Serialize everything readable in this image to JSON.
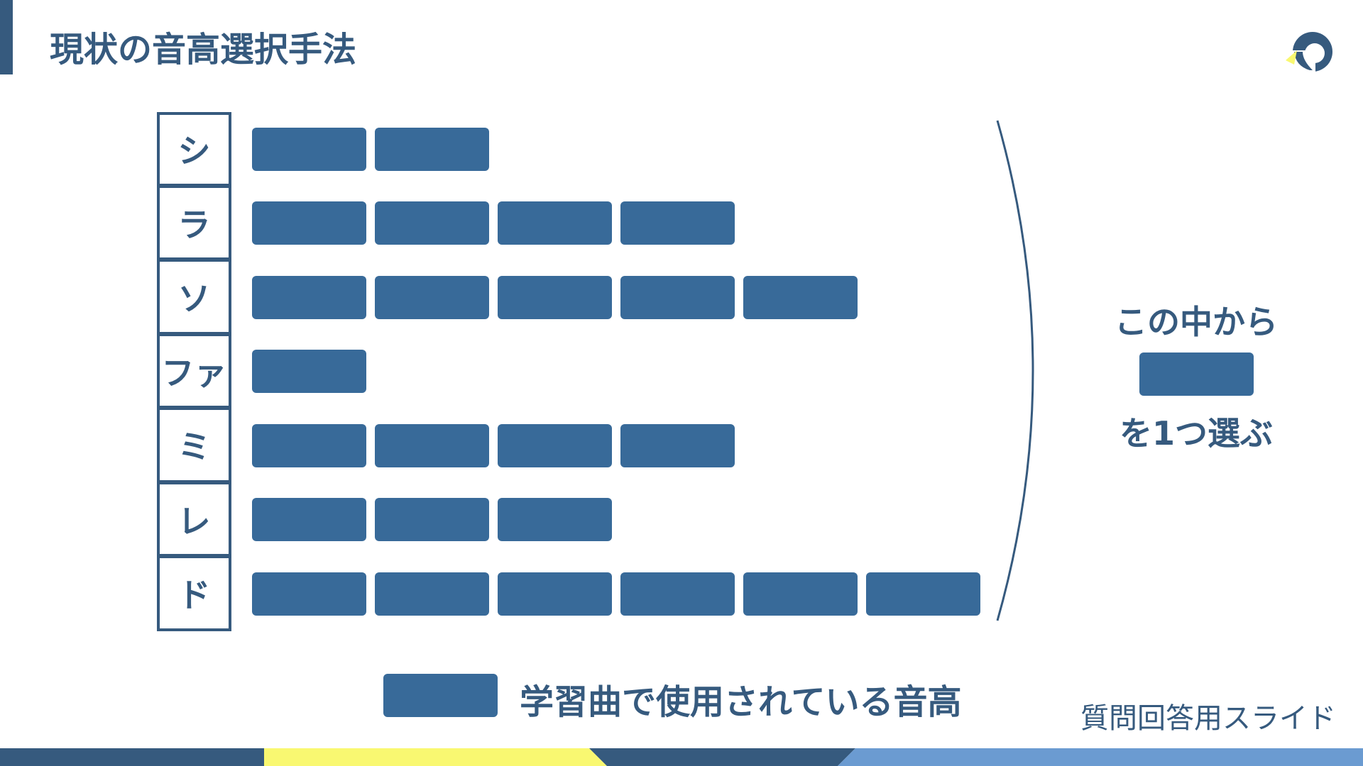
{
  "slide": {
    "title": "現状の音高選択手法",
    "footer_label": "質問回答用スライド"
  },
  "notes": [
    {
      "label": "シ",
      "count": 2
    },
    {
      "label": "ラ",
      "count": 4
    },
    {
      "label": "ソ",
      "count": 5
    },
    {
      "label": "ファ",
      "count": 1
    },
    {
      "label": "ミ",
      "count": 4
    },
    {
      "label": "レ",
      "count": 3
    },
    {
      "label": "ド",
      "count": 6
    }
  ],
  "side_note": {
    "line1": "この中から",
    "line2": "を1つ選ぶ"
  },
  "legend": {
    "label": "学習曲で使用されている音高"
  },
  "colors": {
    "primary": "#365a7e",
    "block": "#386a99",
    "yellow": "#f9f871",
    "light_blue": "#6b9bd1"
  }
}
